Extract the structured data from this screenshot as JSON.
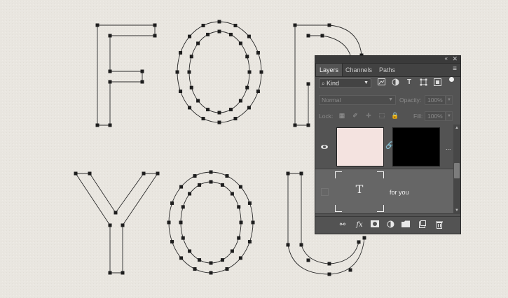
{
  "artwork": {
    "line1": "F O R",
    "line2": "Y O U"
  },
  "panel": {
    "collapse_icon": "double-chevron-left-icon",
    "close_icon": "close-icon",
    "tabs": [
      {
        "label": "Layers",
        "active": true
      },
      {
        "label": "Channels",
        "active": false
      },
      {
        "label": "Paths",
        "active": false
      }
    ],
    "filter": {
      "kind_label": "Kind",
      "icons": [
        "image-filter-icon",
        "adjustment-filter-icon",
        "type-filter-icon",
        "shape-filter-icon",
        "smart-object-filter-icon"
      ]
    },
    "blend": {
      "mode": "Normal",
      "opacity_label": "Opacity:",
      "opacity_value": "100%"
    },
    "lock": {
      "label": "Lock:",
      "fill_label": "Fill:",
      "fill_value": "100%"
    },
    "layers": [
      {
        "type": "shape",
        "name": "",
        "visible": true,
        "thumb_color": "#f4e3e0",
        "mask_color": "#000000"
      },
      {
        "type": "text",
        "name": "for you",
        "visible": false,
        "selected": true
      }
    ],
    "bottom_icons": [
      "link-layers-icon",
      "fx-icon",
      "add-mask-icon",
      "adjustment-layer-icon",
      "new-group-icon",
      "new-layer-icon",
      "trash-icon"
    ]
  },
  "colors": {
    "canvas_bg": "#e9e6e0",
    "panel_bg": "#535353",
    "selected_row": "#666666",
    "path_stroke": "#2a2a2a"
  }
}
